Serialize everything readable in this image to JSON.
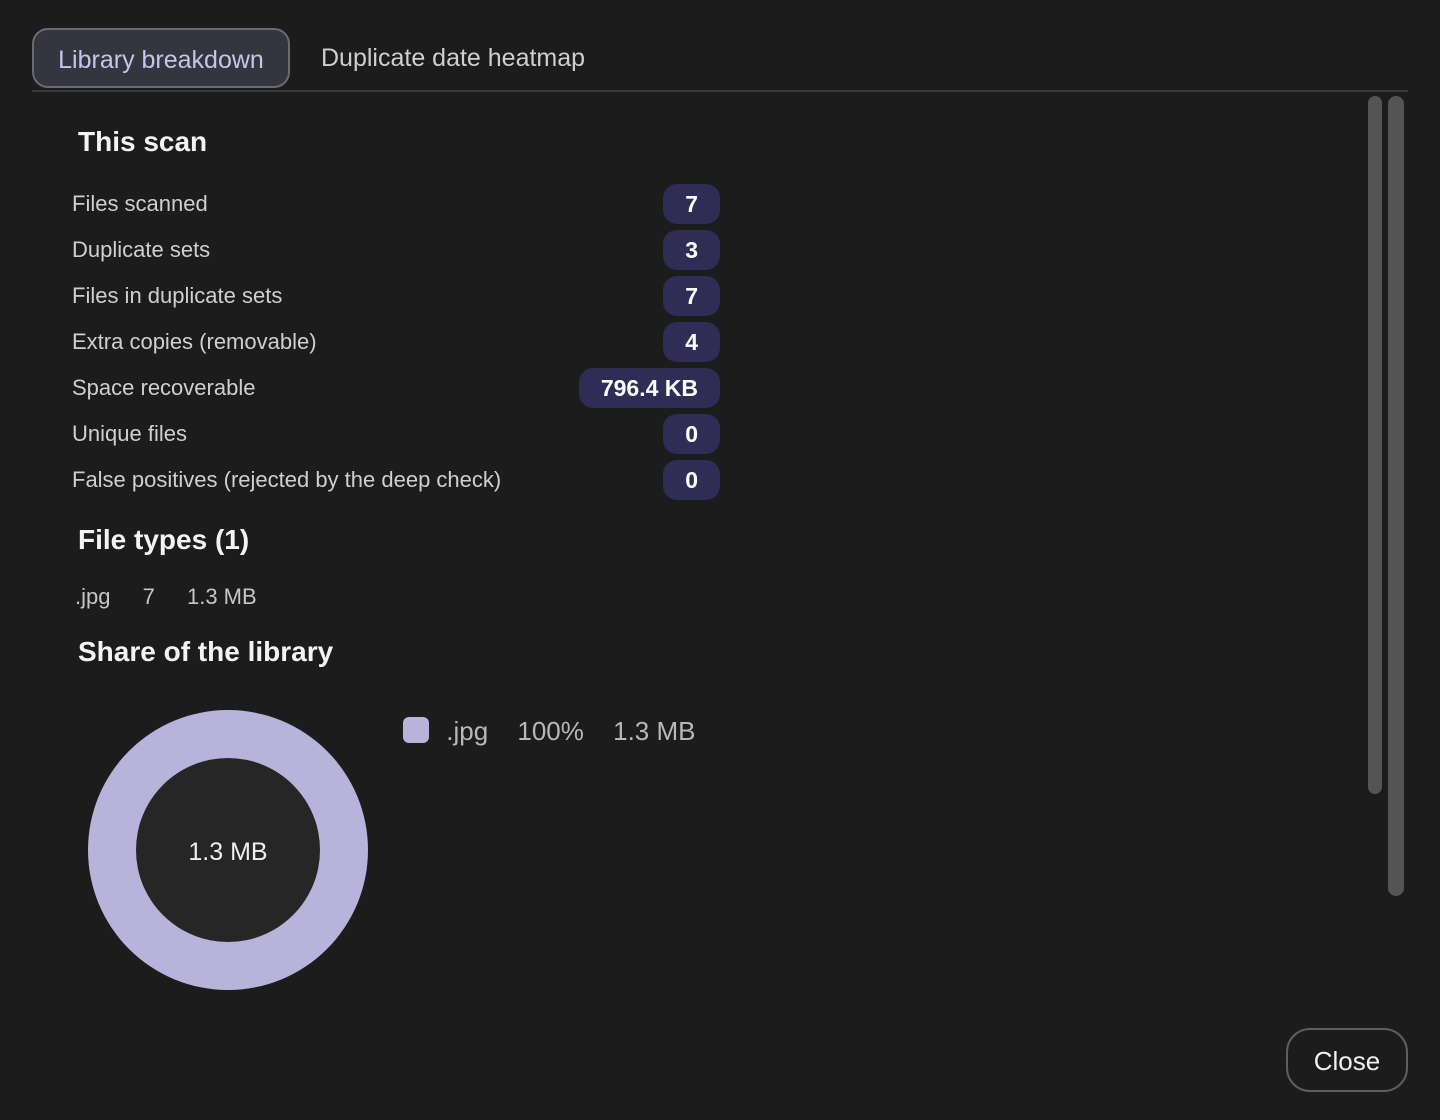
{
  "tabs": [
    {
      "label": "Library breakdown",
      "active": true
    },
    {
      "label": "Duplicate date heatmap",
      "active": false
    }
  ],
  "scan": {
    "title": "This scan",
    "stats": [
      {
        "label": "Files scanned",
        "value": "7"
      },
      {
        "label": "Duplicate sets",
        "value": "3"
      },
      {
        "label": "Files in duplicate sets",
        "value": "7"
      },
      {
        "label": "Extra copies (removable)",
        "value": "4"
      },
      {
        "label": "Space recoverable",
        "value": "796.4 KB"
      },
      {
        "label": "Unique files",
        "value": "0"
      },
      {
        "label": "False positives (rejected by the deep check)",
        "value": "0"
      }
    ]
  },
  "file_types": {
    "title": "File types  (1)",
    "rows": [
      {
        "ext": ".jpg",
        "count": "7",
        "size": "1.3 MB"
      }
    ]
  },
  "share": {
    "title": "Share of the library",
    "center_label": "1.3 MB",
    "legend": [
      {
        "ext": ".jpg",
        "percent": "100%",
        "size": "1.3 MB",
        "color": "#b8b3db"
      }
    ]
  },
  "chart_data": {
    "type": "pie",
    "categories": [
      ".jpg"
    ],
    "values": [
      100
    ],
    "colors": [
      "#b8b3db"
    ]
  },
  "colors": {
    "background": "#1c1c1c",
    "badge": "#2f2c55",
    "accent": "#b8b3db"
  },
  "footer": {
    "close_label": "Close"
  }
}
